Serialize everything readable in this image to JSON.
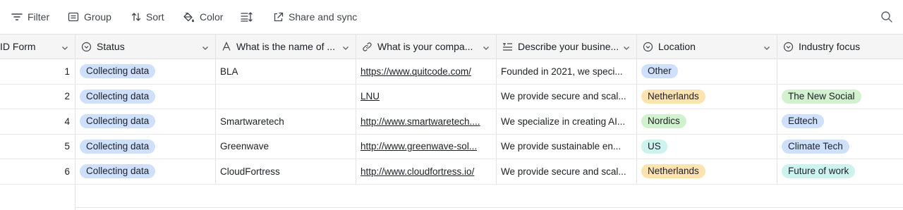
{
  "toolbar": {
    "filter_label": "Filter",
    "group_label": "Group",
    "sort_label": "Sort",
    "color_label": "Color",
    "share_label": "Share and sync"
  },
  "columns": [
    {
      "label": "ID Form",
      "icon": "none"
    },
    {
      "label": "Status",
      "icon": "single-select-icon"
    },
    {
      "label": "What is the name of ...",
      "icon": "text-field-icon"
    },
    {
      "label": "What is your compa...",
      "icon": "link-icon"
    },
    {
      "label": "Describe your busine...",
      "icon": "long-text-icon"
    },
    {
      "label": "Location",
      "icon": "single-select-icon"
    },
    {
      "label": "Industry focus",
      "icon": "single-select-icon"
    }
  ],
  "rows": [
    {
      "id": "1",
      "status": "Collecting data",
      "name": "BLA",
      "url": "https://www.quitcode.com/",
      "desc": "Founded in 2021, we speci...",
      "location": "Other",
      "industry": ""
    },
    {
      "id": "2",
      "status": "Collecting data",
      "name": "",
      "url": "LNU",
      "desc": "We provide secure and scal...",
      "location": "Netherlands",
      "industry": "The New Social"
    },
    {
      "id": "4",
      "status": "Collecting data",
      "name": "Smartwaretech",
      "url": "http://www.smartwaretech....",
      "desc": "We specialize in creating AI...",
      "location": "Nordics",
      "industry": "Edtech"
    },
    {
      "id": "5",
      "status": "Collecting data",
      "name": "Greenwave",
      "url": "http://www.greenwave-sol...",
      "desc": "We provide sustainable en...",
      "location": "US",
      "industry": "Climate Tech"
    },
    {
      "id": "6",
      "status": "Collecting data",
      "name": "CloudFortress",
      "url": "http://www.cloudfortress.io/",
      "desc": "We provide secure and scal...",
      "location": "Netherlands",
      "industry": "Future of work"
    }
  ],
  "colors": {
    "status_pill": "#cfe0fc",
    "Other": "#cfe0fc",
    "Netherlands": "#fde3b0",
    "Nordics": "#d1f1cf",
    "US": "#cdf3ef",
    "The New Social": "#d1f1cf",
    "Edtech": "#cfe0fc",
    "Climate Tech": "#cfe0fc",
    "Future of work": "#cdf3ef"
  }
}
